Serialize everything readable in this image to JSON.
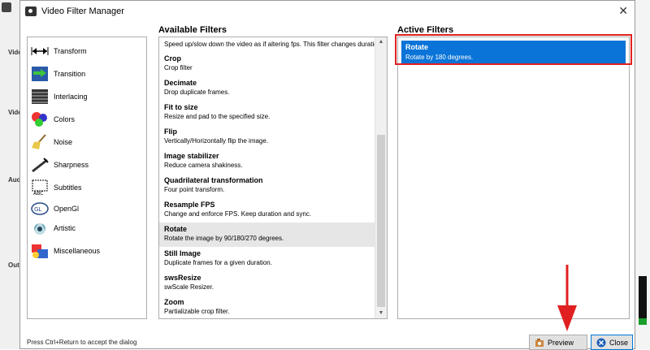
{
  "window": {
    "title": "Video Filter Manager"
  },
  "background": {
    "labels": [
      "Vide",
      "Vide",
      "Audi",
      "Out"
    ]
  },
  "headings": {
    "available": "Available Filters",
    "active": "Active Filters"
  },
  "categories": [
    {
      "label": "Transform",
      "icon": "transform-icon"
    },
    {
      "label": "Transition",
      "icon": "transition-icon"
    },
    {
      "label": "Interlacing",
      "icon": "interlacing-icon"
    },
    {
      "label": "Colors",
      "icon": "colors-icon"
    },
    {
      "label": "Noise",
      "icon": "noise-broom-icon"
    },
    {
      "label": "Sharpness",
      "icon": "sharpness-icon"
    },
    {
      "label": "Subtitles",
      "icon": "subtitles-icon"
    },
    {
      "label": "OpenGl",
      "icon": "opengl-icon"
    },
    {
      "label": "Artistic",
      "icon": "artistic-icon"
    },
    {
      "label": "Miscellaneous",
      "icon": "miscellaneous-icon"
    }
  ],
  "filters": {
    "top_partial_desc": "Speed up/slow down the video as if altering fps. This filter changes duration.",
    "items": [
      {
        "name": "Crop",
        "desc": "Crop filter"
      },
      {
        "name": "Decimate",
        "desc": "Drop duplicate frames."
      },
      {
        "name": "Fit to size",
        "desc": "Resize and pad to the specified size."
      },
      {
        "name": "Flip",
        "desc": "Vertically/Horizontally flip the image."
      },
      {
        "name": "Image stabilizer",
        "desc": "Reduce camera shakiness."
      },
      {
        "name": "Quadrilateral transformation",
        "desc": "Four point transform."
      },
      {
        "name": "Resample FPS",
        "desc": "Change and enforce FPS. Keep duration and sync."
      },
      {
        "name": "Rotate",
        "desc": "Rotate the image by 90/180/270 degrees."
      },
      {
        "name": "Still Image",
        "desc": "Duplicate frames for a given duration."
      },
      {
        "name": "swsResize",
        "desc": "swScale Resizer."
      },
      {
        "name": "Zoom",
        "desc": "Partializable crop filter."
      }
    ]
  },
  "active_filters": [
    {
      "name": "Rotate",
      "desc": "Rotate by 180 degrees."
    }
  ],
  "footer": {
    "hint": "Press Ctrl+Return to accept the dialog",
    "preview_label": "Preview",
    "close_label": "Close"
  },
  "colors": {
    "selection": "#0a74d8",
    "highlight_box": "#e02020",
    "arrow": "#e02020"
  }
}
